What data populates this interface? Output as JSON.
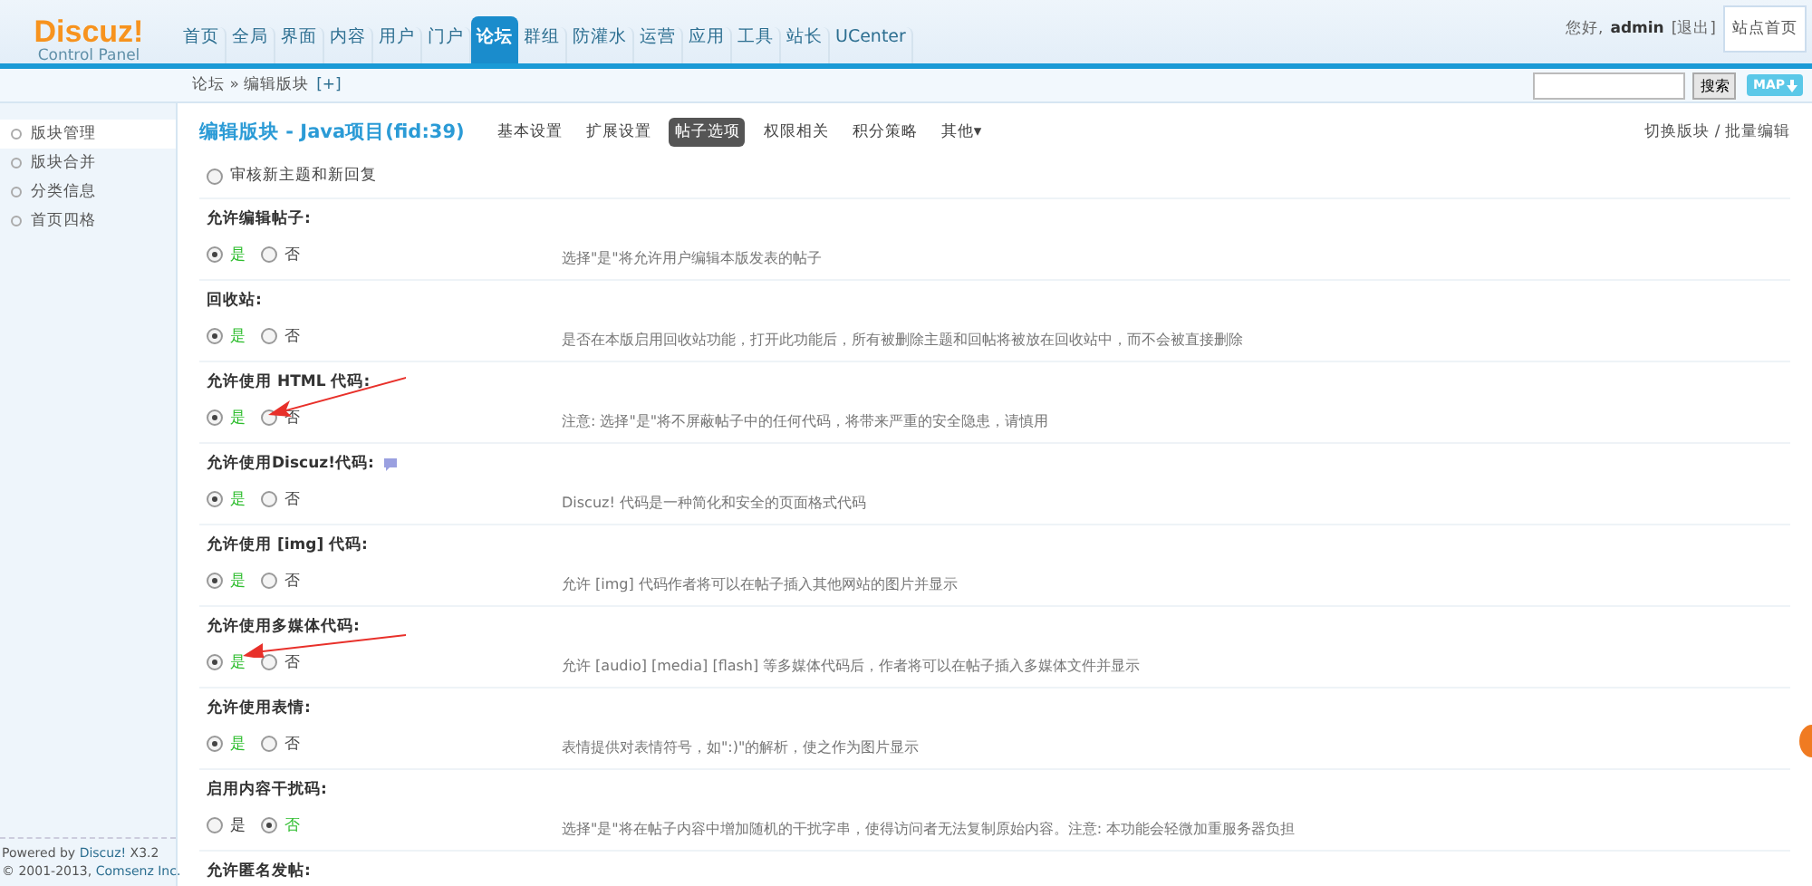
{
  "logo": {
    "name": "Discuz!",
    "subtitle": "Control Panel"
  },
  "nav": [
    {
      "label": "首页",
      "selected": false
    },
    {
      "label": "全局",
      "selected": false
    },
    {
      "label": "界面",
      "selected": false
    },
    {
      "label": "内容",
      "selected": false
    },
    {
      "label": "用户",
      "selected": false
    },
    {
      "label": "门户",
      "selected": false
    },
    {
      "label": "论坛",
      "selected": true
    },
    {
      "label": "群组",
      "selected": false
    },
    {
      "label": "防灌水",
      "selected": false
    },
    {
      "label": "运营",
      "selected": false
    },
    {
      "label": "应用",
      "selected": false
    },
    {
      "label": "工具",
      "selected": false
    },
    {
      "label": "站长",
      "selected": false
    },
    {
      "label": "UCenter",
      "selected": false
    }
  ],
  "user": {
    "greeting": "您好,",
    "name": "admin",
    "logout": "[退出]",
    "home_button": "站点首页"
  },
  "breadcrumb": {
    "path": "论坛 » 编辑版块",
    "add": "[+]"
  },
  "search": {
    "button": "搜索",
    "map": "MAP"
  },
  "sidebar": {
    "items": [
      {
        "label": "版块管理",
        "selected": true
      },
      {
        "label": "版块合并",
        "selected": false
      },
      {
        "label": "分类信息",
        "selected": false
      },
      {
        "label": "首页四格",
        "selected": false
      }
    ],
    "footer": {
      "powered": "Powered by",
      "powered_link": "Discuz!",
      "version": "X3.2",
      "copyright": "© 2001-2013,",
      "company": "Comsenz Inc."
    }
  },
  "content": {
    "title": "编辑版块 - Java项目(fid:39)",
    "tabs": [
      {
        "label": "基本设置",
        "selected": false
      },
      {
        "label": "扩展设置",
        "selected": false
      },
      {
        "label": "帖子选项",
        "selected": true
      },
      {
        "label": "权限相关",
        "selected": false
      },
      {
        "label": "积分策略",
        "selected": false
      },
      {
        "label": "其他▾",
        "selected": false
      }
    ],
    "switcher": "切换版块 / 批量编辑",
    "settings": [
      {
        "kind": "check",
        "label": "审核新主题和新回复",
        "checked": false
      },
      {
        "kind": "yesno",
        "label": "允许编辑帖子:",
        "options": [
          {
            "label": "是",
            "selected": true
          },
          {
            "label": "否",
            "selected": false
          }
        ],
        "description": "选择\"是\"将允许用户编辑本版发表的帖子"
      },
      {
        "kind": "yesno",
        "label": "回收站:",
        "options": [
          {
            "label": "是",
            "selected": true
          },
          {
            "label": "否",
            "selected": false
          }
        ],
        "description": "是否在本版启用回收站功能，打开此功能后，所有被删除主题和回帖将被放在回收站中，而不会被直接删除"
      },
      {
        "kind": "yesno",
        "label": "允许使用 HTML 代码:",
        "options": [
          {
            "label": "是",
            "selected": true
          },
          {
            "label": "否",
            "selected": false
          }
        ],
        "description": "注意: 选择\"是\"将不屏蔽帖子中的任何代码，将带来严重的安全隐患，请慎用"
      },
      {
        "kind": "yesno",
        "label": "允许使用Discuz!代码:",
        "help": true,
        "options": [
          {
            "label": "是",
            "selected": true
          },
          {
            "label": "否",
            "selected": false
          }
        ],
        "description": "Discuz! 代码是一种简化和安全的页面格式代码"
      },
      {
        "kind": "yesno",
        "label": "允许使用 [img] 代码:",
        "options": [
          {
            "label": "是",
            "selected": true
          },
          {
            "label": "否",
            "selected": false
          }
        ],
        "description": "允许 [img] 代码作者将可以在帖子插入其他网站的图片并显示"
      },
      {
        "kind": "yesno",
        "label": "允许使用多媒体代码:",
        "options": [
          {
            "label": "是",
            "selected": true
          },
          {
            "label": "否",
            "selected": false
          }
        ],
        "description": "允许 [audio] [media] [flash] 等多媒体代码后，作者将可以在帖子插入多媒体文件并显示"
      },
      {
        "kind": "yesno",
        "label": "允许使用表情:",
        "options": [
          {
            "label": "是",
            "selected": true
          },
          {
            "label": "否",
            "selected": false
          }
        ],
        "description": "表情提供对表情符号，如\":)\"的解析，使之作为图片显示"
      },
      {
        "kind": "yesno",
        "label": "启用内容干扰码:",
        "options": [
          {
            "label": "是",
            "selected": false
          },
          {
            "label": "否",
            "selected": true
          }
        ],
        "description": "选择\"是\"将在帖子内容中增加随机的干扰字串，使得访问者无法复制原始内容。注意: 本功能会轻微加重服务器负担"
      },
      {
        "kind": "heading",
        "label": "允许匿名发帖:"
      }
    ]
  }
}
